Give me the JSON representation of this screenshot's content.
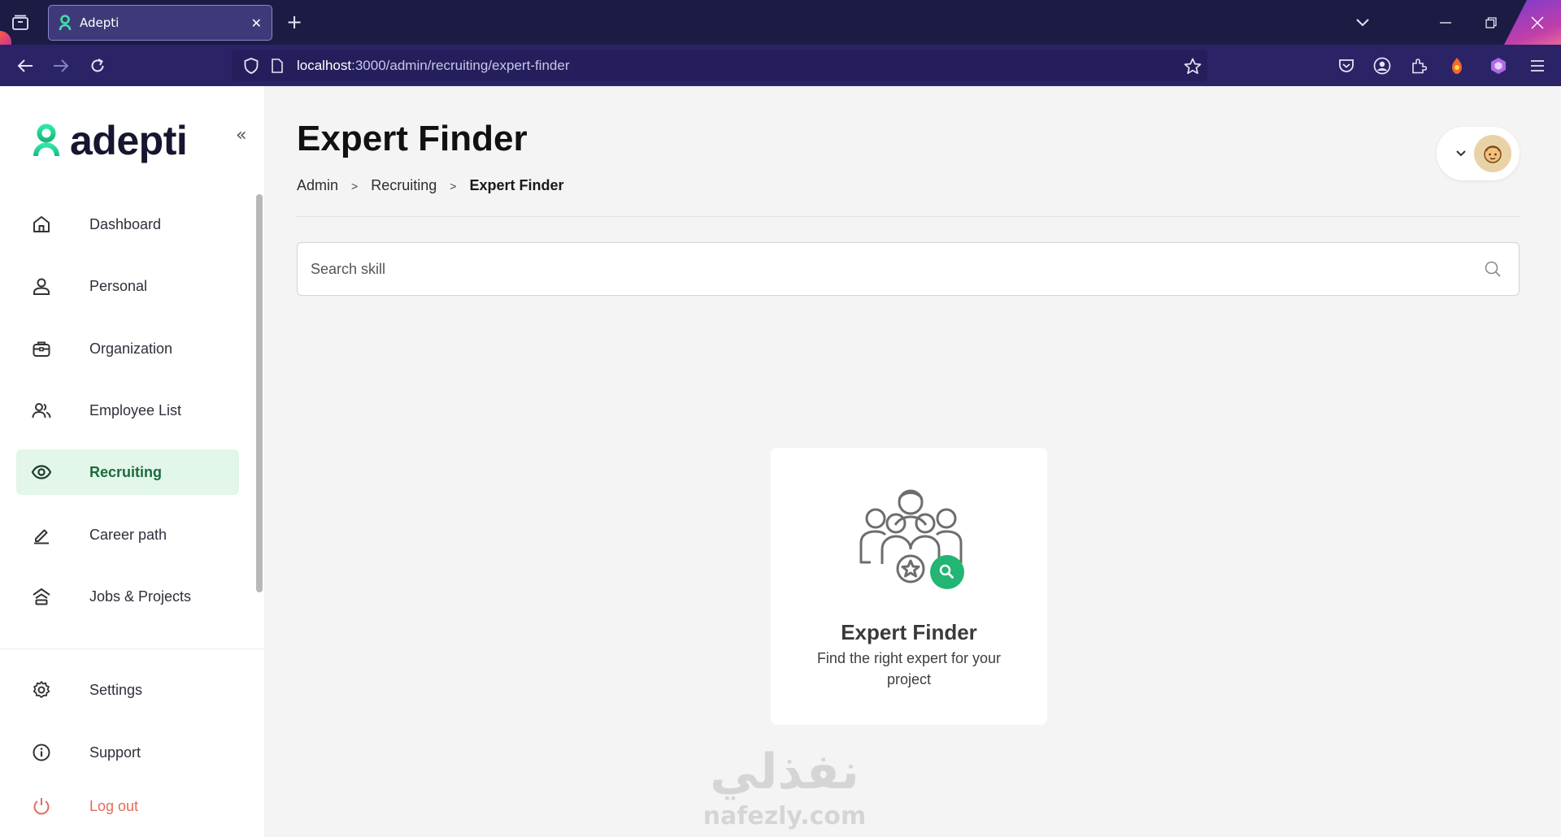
{
  "browser": {
    "tab_title": "Adepti",
    "url_host": "localhost",
    "url_path": ":3000/admin/recruiting/expert-finder"
  },
  "sidebar": {
    "logo_text": "adepti",
    "items": [
      {
        "label": "Dashboard",
        "icon": "home-icon"
      },
      {
        "label": "Personal",
        "icon": "user-icon"
      },
      {
        "label": "Organization",
        "icon": "briefcase-icon"
      },
      {
        "label": "Employee List",
        "icon": "users-icon"
      },
      {
        "label": "Recruiting",
        "icon": "eye-icon",
        "active": true
      },
      {
        "label": "Career path",
        "icon": "pen-icon"
      },
      {
        "label": "Jobs & Projects",
        "icon": "jobs-icon"
      }
    ],
    "bottom_items": [
      {
        "label": "Settings",
        "icon": "gear-icon"
      },
      {
        "label": "Support",
        "icon": "info-icon"
      },
      {
        "label": "Log out",
        "icon": "power-icon"
      }
    ]
  },
  "header": {
    "title": "Expert Finder",
    "breadcrumb": [
      "Admin",
      "Recruiting",
      "Expert Finder"
    ]
  },
  "search": {
    "placeholder": "Search skill",
    "value": ""
  },
  "empty_state": {
    "title": "Expert Finder",
    "description": "Find the right expert for your project"
  },
  "watermark": {
    "arabic": "نفذلي",
    "latin": "nafezly.com"
  },
  "colors": {
    "accent": "#22b573",
    "active_bg": "#e2f6ea",
    "active_text": "#1c6b3c",
    "logout": "#e36b5a",
    "browser_tab_bar": "#1c1b44",
    "browser_nav_bar": "#2a2466"
  }
}
